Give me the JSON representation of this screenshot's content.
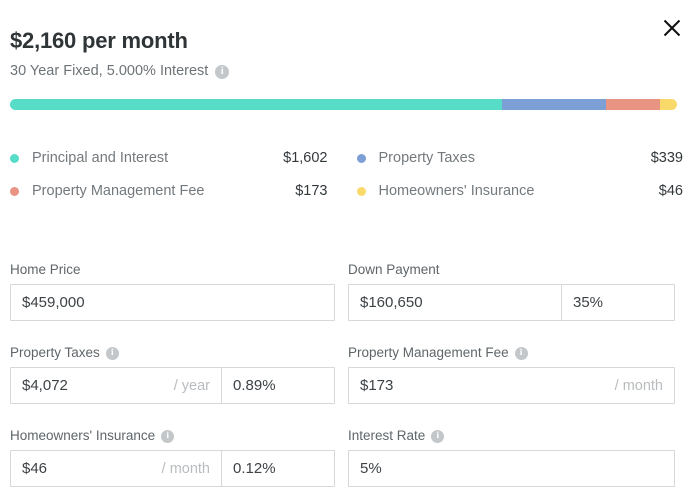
{
  "header": {
    "headline": "$2,160 per month",
    "subline": "30 Year Fixed, 5.000% Interest",
    "info_glyph": "i"
  },
  "close": {
    "label": "×",
    "name": "close-icon"
  },
  "colors": {
    "principal_interest": "#57DCC7",
    "property_taxes": "#7C9FD6",
    "property_management_fee": "#E99383",
    "homeowners_insurance": "#F9D96A"
  },
  "breakdown_bar": {
    "segments": [
      {
        "key": "principal_interest",
        "percent": 73.8,
        "color": "#57DCC7"
      },
      {
        "key": "property_taxes",
        "percent": 15.6,
        "color": "#7C9FD6"
      },
      {
        "key": "property_management_fee",
        "percent": 8.0,
        "color": "#E99383"
      },
      {
        "key": "homeowners_insurance",
        "percent": 2.6,
        "color": "#F9D96A"
      }
    ]
  },
  "legend": [
    {
      "label": "Principal and Interest",
      "value": "$1,602",
      "color": "#57DCC7"
    },
    {
      "label": "Property Taxes",
      "value": "$339",
      "color": "#7C9FD6"
    },
    {
      "label": "Property Management Fee",
      "value": "$173",
      "color": "#E99383"
    },
    {
      "label": "Homeowners' Insurance",
      "value": "$46",
      "color": "#F9D96A"
    }
  ],
  "fields": {
    "home_price": {
      "label": "Home Price",
      "value": "$459,000"
    },
    "down_payment": {
      "label": "Down Payment",
      "value": "$160,650",
      "percent": "35%"
    },
    "property_taxes": {
      "label": "Property Taxes",
      "value": "$4,072",
      "suffix": "/ year",
      "percent": "0.89%"
    },
    "property_management_fee": {
      "label": "Property Management Fee",
      "value": "$173",
      "suffix": "/ month"
    },
    "homeowners_insurance": {
      "label": "Homeowners' Insurance",
      "value": "$46",
      "suffix": "/ month",
      "percent": "0.12%"
    },
    "interest_rate": {
      "label": "Interest Rate",
      "value": "5%"
    }
  }
}
